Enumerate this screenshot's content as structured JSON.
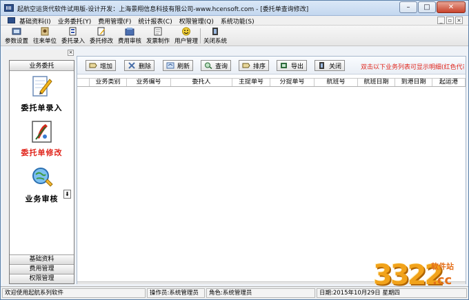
{
  "window": {
    "title": "起航空运货代软件试用版-设计开发：上海景翔信息科技有限公司-www.hcensoft.com - [委托单查询修改]"
  },
  "menu": {
    "items": [
      "基础资料(I)",
      "业务委托(Y)",
      "费用管理(F)",
      "统计报表(C)",
      "权限管理(Q)",
      "系统功能(S)"
    ]
  },
  "toolbar": {
    "buttons": [
      "参数设置",
      "往来单位",
      "委托录入",
      "委托修改",
      "费用审核",
      "发票制作",
      "用户管理",
      "关闭系统"
    ]
  },
  "left_panel": {
    "header": "业务委托",
    "items": [
      {
        "label": "委托单录入",
        "icon": "notepad-pencil-icon"
      },
      {
        "label": "委托单修改",
        "icon": "edit-document-icon"
      },
      {
        "label": "业务审核",
        "icon": "magnifier-globe-icon"
      }
    ],
    "footer_groups": [
      "基础资料",
      "费用管理",
      "权限管理"
    ]
  },
  "actions": {
    "buttons": [
      "增加",
      "删除",
      "刷新",
      "查询",
      "排序",
      "导出",
      "关闭"
    ],
    "hint": "双击以下业务列表可显示明细(红色代表"
  },
  "grid": {
    "columns": [
      "业务类别",
      "业务编号",
      "委托人",
      "主提单号",
      "分提单号",
      "航班号",
      "航班日期",
      "到港日期",
      "起运港"
    ]
  },
  "status": {
    "welcome": "欢迎使用起航系列软件",
    "operator": "操作员:系统管理员",
    "role": "角色:系统管理员",
    "date": "日期:2015年10月29日 星期四"
  },
  "watermark": {
    "digits": "3322",
    "tld": ".cc",
    "site": "软件站"
  },
  "colors": {
    "accent_red": "#e0241b",
    "titlebar": "#c3d7ef"
  }
}
